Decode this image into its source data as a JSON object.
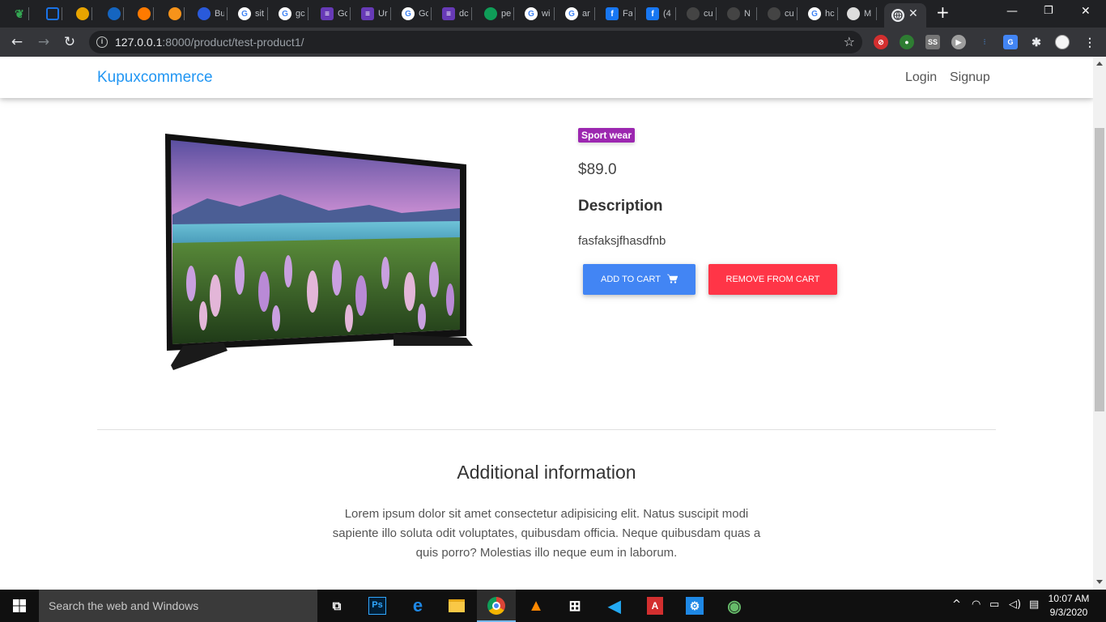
{
  "browser": {
    "tabs": [
      {
        "label": "",
        "icon": "leaf-icon",
        "color": "#34a853"
      },
      {
        "label": "",
        "icon": "square-icon",
        "color": "#1a73e8"
      },
      {
        "label": "",
        "icon": "pnc-icon",
        "color": "#e8a400"
      },
      {
        "label": "",
        "icon": "b-logo-icon",
        "color": "#1565c0"
      },
      {
        "label": "",
        "icon": "molecule-icon",
        "color": "#ff7a00"
      },
      {
        "label": "",
        "icon": "bitcoin-icon",
        "color": "#f7931a"
      },
      {
        "label": "Bu",
        "icon": "bitcoin-blue-icon",
        "color": "#2a5ada"
      },
      {
        "label": "sit",
        "icon": "google-icon",
        "color": "#ffffff"
      },
      {
        "label": "gc",
        "icon": "google-icon",
        "color": "#ffffff"
      },
      {
        "label": "Gc",
        "icon": "forms-icon",
        "color": "#673ab7"
      },
      {
        "label": "Ur",
        "icon": "forms-icon",
        "color": "#673ab7"
      },
      {
        "label": "Gc",
        "icon": "google-icon",
        "color": "#ffffff"
      },
      {
        "label": "dc",
        "icon": "forms-icon",
        "color": "#673ab7"
      },
      {
        "label": "pe",
        "icon": "plus-sheet-icon",
        "color": "#0f9d58"
      },
      {
        "label": "wi",
        "icon": "google-icon",
        "color": "#ffffff"
      },
      {
        "label": "ar",
        "icon": "google-icon",
        "color": "#ffffff"
      },
      {
        "label": "Fa",
        "icon": "facebook-icon",
        "color": "#1877f2"
      },
      {
        "label": "(4",
        "icon": "facebook-icon",
        "color": "#1877f2"
      },
      {
        "label": "cu",
        "icon": "github-icon",
        "color": "#444444"
      },
      {
        "label": "N",
        "icon": "github-icon",
        "color": "#444444"
      },
      {
        "label": "cu",
        "icon": "github-icon",
        "color": "#444444"
      },
      {
        "label": "hc",
        "icon": "google-icon",
        "color": "#ffffff"
      },
      {
        "label": "M",
        "icon": "github-icon",
        "color": "#dddddd"
      }
    ],
    "url_host": "127.0.0.1",
    "url_path": ":8000/product/test-product1/",
    "new_tab": "+",
    "extensions": [
      "SS"
    ]
  },
  "site": {
    "brand": "Kupuxcommerce",
    "nav_login": "Login",
    "nav_signup": "Signup"
  },
  "product": {
    "category_badge": "Sport wear",
    "price": "$89.0",
    "description_heading": "Description",
    "description": "fasfaksjfhasdfnb",
    "add_to_cart": "ADD TO CART",
    "remove_from_cart": "REMOVE FROM CART",
    "image_icon": "tv-product-image"
  },
  "additional": {
    "heading": "Additional information",
    "text": "Lorem ipsum dolor sit amet consectetur adipisicing elit. Natus suscipit modi sapiente illo soluta odit voluptates, quibusdam officia. Neque quibusdam quas a quis porro? Molestias illo neque eum in laborum."
  },
  "taskbar": {
    "search_placeholder": "Search the web and Windows",
    "time": "10:07 AM",
    "date": "9/3/2020",
    "ps_label": "Ps"
  },
  "colors": {
    "brand": "#2196f3",
    "badge": "#9c27b0",
    "add_button": "#4285f4",
    "remove_button": "#ff3547"
  }
}
